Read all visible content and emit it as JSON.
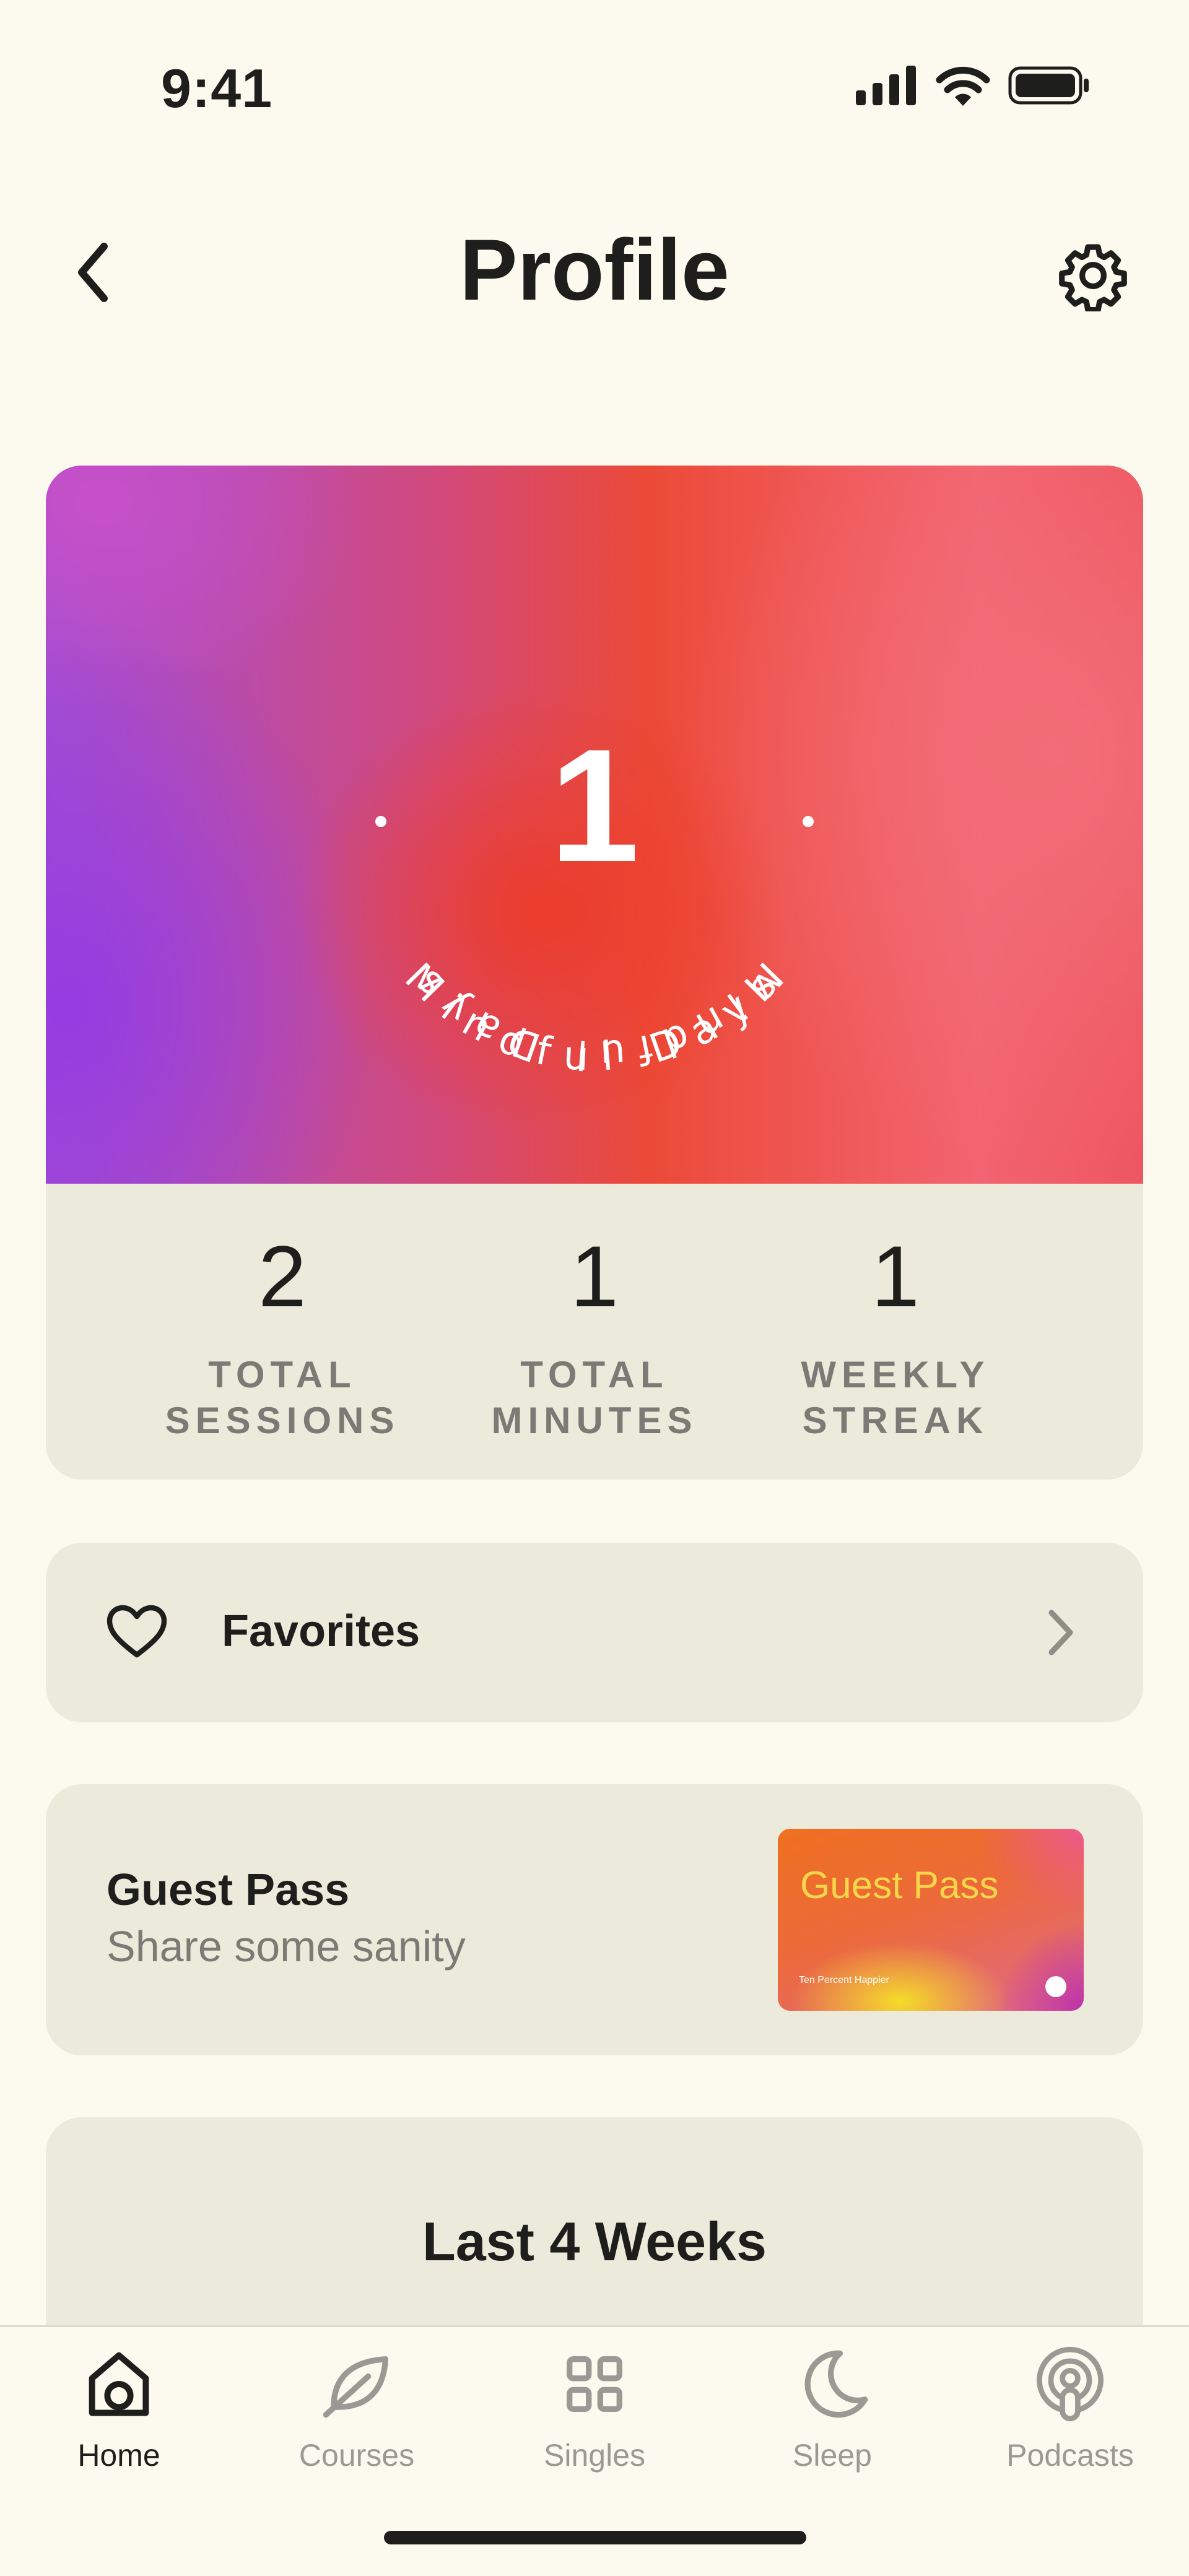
{
  "status_bar": {
    "time": "9:41"
  },
  "header": {
    "title": "Profile"
  },
  "mindful_card": {
    "value": "1",
    "ring_text": "Mindful Days",
    "colors": {
      "purple": "#A24FD2",
      "red": "#EC4A38",
      "pink": "#F26470"
    }
  },
  "stats": [
    {
      "value": "2",
      "label_line1": "TOTAL",
      "label_line2": "SESSIONS"
    },
    {
      "value": "1",
      "label_line1": "TOTAL",
      "label_line2": "MINUTES"
    },
    {
      "value": "1",
      "label_line1": "WEEKLY",
      "label_line2": "STREAK"
    }
  ],
  "favorites": {
    "label": "Favorites",
    "icon": "heart-icon"
  },
  "guest_pass": {
    "title": "Guest Pass",
    "subtitle": "Share some sanity",
    "card_title": "Guest Pass",
    "card_brand": "Ten Percent Happier"
  },
  "weeks": {
    "title": "Last 4 Weeks"
  },
  "tabs": [
    {
      "label": "Home",
      "icon": "home-icon",
      "active": true
    },
    {
      "label": "Courses",
      "icon": "leaf-icon",
      "active": false
    },
    {
      "label": "Singles",
      "icon": "grid-icon",
      "active": false
    },
    {
      "label": "Sleep",
      "icon": "moon-icon",
      "active": false
    },
    {
      "label": "Podcasts",
      "icon": "podcast-icon",
      "active": false
    }
  ],
  "colors": {
    "background": "#FCFAEE",
    "card": "#ECEADB",
    "text": "#1E1E1C",
    "muted": "#7B7A75"
  }
}
